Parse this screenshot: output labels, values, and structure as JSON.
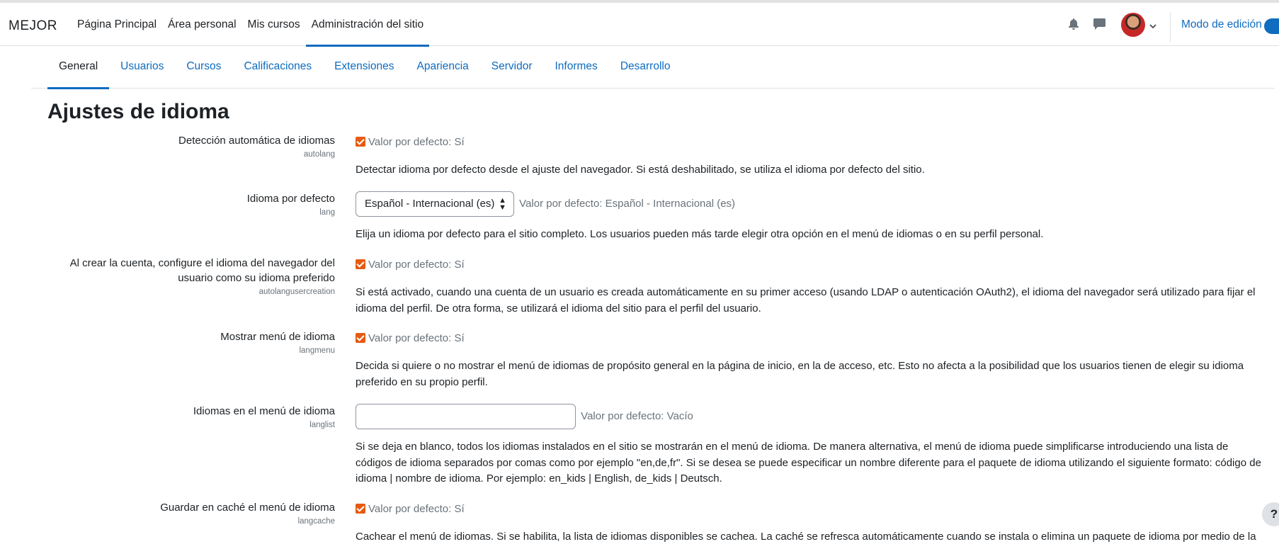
{
  "brand": "MEJOR",
  "topnav": [
    "Página Principal",
    "Área personal",
    "Mis cursos",
    "Administración del sitio"
  ],
  "edit_mode_label": "Modo de edición",
  "subnav": [
    "General",
    "Usuarios",
    "Cursos",
    "Calificaciones",
    "Extensiones",
    "Apariencia",
    "Servidor",
    "Informes",
    "Desarrollo"
  ],
  "page_title": "Ajustes de idioma",
  "settings": [
    {
      "title": "Detección automática de idiomas",
      "key": "autolang",
      "default": "Valor por defecto: Sí",
      "description": "Detectar idioma por defecto desde el ajuste del navegador. Si está deshabilitado, se utiliza el idioma por defecto del sitio."
    },
    {
      "title": "Idioma por defecto",
      "key": "lang",
      "selected": "Español - Internacional (es)",
      "default": "Valor por defecto: Español - Internacional (es)",
      "description": "Elija un idioma por defecto para el sitio completo. Los usuarios pueden más tarde elegir otra opción en el menú de idiomas o en su perfil personal."
    },
    {
      "title": "Al crear la cuenta, configure el idioma del navegador del usuario como su idioma preferido",
      "key": "autolangusercreation",
      "default": "Valor por defecto: Sí",
      "description": "Si está activado, cuando una cuenta de un usuario es creada automáticamente en su primer acceso (usando LDAP o autenticación OAuth2), el idioma del navegador será utilizado para fijar el idioma del perfil. De otra forma, se utilizará el idioma del sitio para el perfil del usuario."
    },
    {
      "title": "Mostrar menú de idioma",
      "key": "langmenu",
      "default": "Valor por defecto: Sí",
      "description": "Decida si quiere o no mostrar el menú de idiomas de propósito general en la página de inicio, en la de acceso, etc. Esto no afecta a la posibilidad que los usuarios tienen de elegir su idioma preferido en su propio perfil."
    },
    {
      "title": "Idiomas en el menú de idioma",
      "key": "langlist",
      "value": "",
      "default": "Valor por defecto: Vacío",
      "description": "Si se deja en blanco, todos los idiomas instalados en el sitio se mostrarán en el menú de idioma. De manera alternativa, el menú de idioma puede simplificarse introduciendo una lista de códigos de idioma separados por comas como por ejemplo \"en,de,fr\". Si se desea se puede especificar un nombre diferente para el paquete de idioma utilizando el siguiente formato: código de idioma | nombre de idioma. Por ejemplo: en_kids | English, de_kids | Deutsch."
    },
    {
      "title": "Guardar en caché el menú de idioma",
      "key": "langcache",
      "default": "Valor por defecto: Sí",
      "description": "Cachear el menú de idiomas. Si se habilita, la lista de idiomas disponibles se cachea. La caché se refresca automáticamente cuando se instala o elimina un paquete de idioma por medio de la"
    }
  ],
  "help_label": "?",
  "colors": {
    "accent": "#0f6cbf",
    "checkbox": "#e55b13",
    "muted": "#6a737b"
  }
}
